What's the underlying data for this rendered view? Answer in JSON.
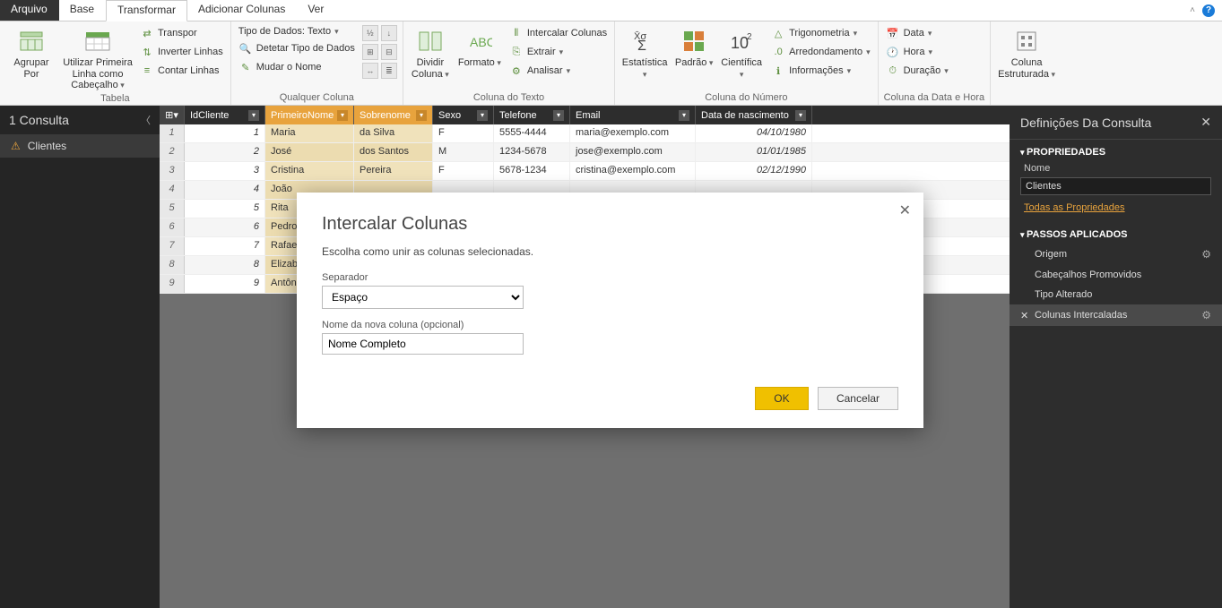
{
  "tabs": {
    "file": "Arquivo",
    "base": "Base",
    "transform": "Transformar",
    "addcols": "Adicionar Colunas",
    "view": "Ver"
  },
  "ribbon": {
    "table": {
      "group": "Tabela",
      "groupby": "Agrupar Por",
      "firstrow": "Utilizar Primeira Linha como Cabeçalho",
      "transpose": "Transpor",
      "reverse": "Inverter Linhas",
      "count": "Contar Linhas"
    },
    "anycol": {
      "group": "Qualquer Coluna",
      "datatype": "Tipo de Dados: Texto",
      "detect": "Detetar Tipo de Dados",
      "rename": "Mudar o Nome"
    },
    "textcol": {
      "group": "Coluna do Texto",
      "split": "Dividir Coluna",
      "format": "Formato",
      "merge": "Intercalar Colunas",
      "extract": "Extrair",
      "parse": "Analisar"
    },
    "numcol": {
      "group": "Coluna do Número",
      "stats": "Estatística",
      "standard": "Padrão",
      "scientific": "Científica",
      "trig": "Trigonometria",
      "round": "Arredondamento",
      "info": "Informações"
    },
    "datecol": {
      "group": "Coluna da Data e Hora",
      "date": "Data",
      "time": "Hora",
      "duration": "Duração"
    },
    "struct": {
      "group": "",
      "structured": "Coluna Estruturada"
    }
  },
  "left": {
    "header": "1 Consulta",
    "query": "Clientes"
  },
  "grid": {
    "headers": {
      "id": "IdCliente",
      "first": "PrimeiroNome",
      "last": "Sobrenome",
      "sex": "Sexo",
      "tel": "Telefone",
      "email": "Email",
      "dob": "Data de nascimento"
    },
    "rows": [
      {
        "n": "1",
        "id": "1",
        "first": "Maria",
        "last": "da Silva",
        "sex": "F",
        "tel": "5555-4444",
        "email": "maria@exemplo.com",
        "dob": "04/10/1980"
      },
      {
        "n": "2",
        "id": "2",
        "first": "José",
        "last": "dos Santos",
        "sex": "M",
        "tel": "1234-5678",
        "email": "jose@exemplo.com",
        "dob": "01/01/1985"
      },
      {
        "n": "3",
        "id": "3",
        "first": "Cristina",
        "last": "Pereira",
        "sex": "F",
        "tel": "5678-1234",
        "email": "cristina@exemplo.com",
        "dob": "02/12/1990"
      },
      {
        "n": "4",
        "id": "4",
        "first": "João",
        "last": "",
        "sex": "",
        "tel": "",
        "email": "",
        "dob": ""
      },
      {
        "n": "5",
        "id": "5",
        "first": "Rita",
        "last": "",
        "sex": "",
        "tel": "",
        "email": "",
        "dob": ""
      },
      {
        "n": "6",
        "id": "6",
        "first": "Pedro",
        "last": "",
        "sex": "",
        "tel": "",
        "email": "",
        "dob": ""
      },
      {
        "n": "7",
        "id": "7",
        "first": "Rafael",
        "last": "",
        "sex": "",
        "tel": "",
        "email": "",
        "dob": ""
      },
      {
        "n": "8",
        "id": "8",
        "first": "Elizab",
        "last": "",
        "sex": "",
        "tel": "",
        "email": "",
        "dob": ""
      },
      {
        "n": "9",
        "id": "9",
        "first": "Antôn",
        "last": "",
        "sex": "",
        "tel": "",
        "email": "",
        "dob": ""
      }
    ]
  },
  "right": {
    "title": "Definições Da Consulta",
    "props": "PROPRIEDADES",
    "name_label": "Nome",
    "name_value": "Clientes",
    "allprops": "Todas as Propriedades",
    "steps_hdr": "PASSOS APLICADOS",
    "steps": [
      {
        "label": "Origem",
        "gear": true
      },
      {
        "label": "Cabeçalhos Promovidos",
        "gear": false
      },
      {
        "label": "Tipo Alterado",
        "gear": false
      },
      {
        "label": "Colunas Intercaladas",
        "gear": true,
        "active": true
      }
    ]
  },
  "dialog": {
    "title": "Intercalar Colunas",
    "subtitle": "Escolha como unir as colunas selecionadas.",
    "sep_label": "Separador",
    "sep_value": "Espaço",
    "newcol_label": "Nome da nova coluna (opcional)",
    "newcol_value": "Nome Completo",
    "ok": "OK",
    "cancel": "Cancelar"
  }
}
